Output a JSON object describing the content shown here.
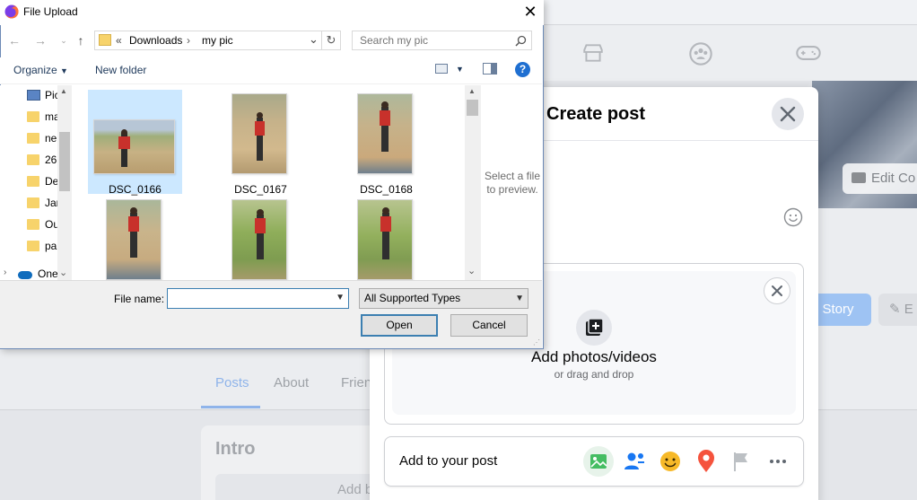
{
  "file_dialog": {
    "title": "File Upload",
    "address": {
      "overflow": "«",
      "crumbs": [
        "Downloads",
        "my pic"
      ]
    },
    "search_placeholder": "Search my pic",
    "toolbar": {
      "organize": "Organize",
      "new_folder": "New folder",
      "help": "?"
    },
    "tree": [
      {
        "label": "Pic",
        "type": "pictures"
      },
      {
        "label": "ma",
        "type": "folder"
      },
      {
        "label": "ne",
        "type": "folder"
      },
      {
        "label": "26",
        "type": "folder"
      },
      {
        "label": "De",
        "type": "folder"
      },
      {
        "label": "Jar",
        "type": "folder"
      },
      {
        "label": "Ou",
        "type": "folder"
      },
      {
        "label": "pa",
        "type": "folder"
      },
      {
        "label": "One",
        "type": "onedrive"
      }
    ],
    "files": [
      {
        "name": "DSC_0166",
        "selected": true
      },
      {
        "name": "DSC_0167",
        "selected": false
      },
      {
        "name": "DSC_0168",
        "selected": false
      },
      {
        "name": "",
        "selected": false
      },
      {
        "name": "",
        "selected": false
      },
      {
        "name": "",
        "selected": false
      }
    ],
    "preview_text_1": "Select a file",
    "preview_text_2": "to preview.",
    "file_name_label": "File name:",
    "file_name_value": "",
    "file_type": "All Supported Types",
    "open_label": "Open",
    "cancel_label": "Cancel",
    "colors": {
      "selection": "#cce8ff",
      "accent": "#3c7fb1",
      "folder": "#f7d36b"
    }
  },
  "create_post": {
    "title": "Create post",
    "upload_title": "Add photos/videos",
    "upload_sub": "or drag and drop",
    "add_to_post": "Add to your post",
    "add_icons": [
      "photo-icon",
      "tag-people-icon",
      "feeling-icon",
      "check-in-icon",
      "flag-icon",
      "more-icon"
    ],
    "colors": {
      "photo": "#45bd62",
      "tag": "#1877f2",
      "feeling": "#f7b928",
      "checkin": "#f5533d"
    }
  },
  "background_page": {
    "edit_cover": "Edit Co",
    "story_button": "o Story",
    "edit_button": "E",
    "tabs": [
      "Posts",
      "About",
      "Frien"
    ],
    "intro_title": "Intro",
    "intro_button": "Add b"
  }
}
